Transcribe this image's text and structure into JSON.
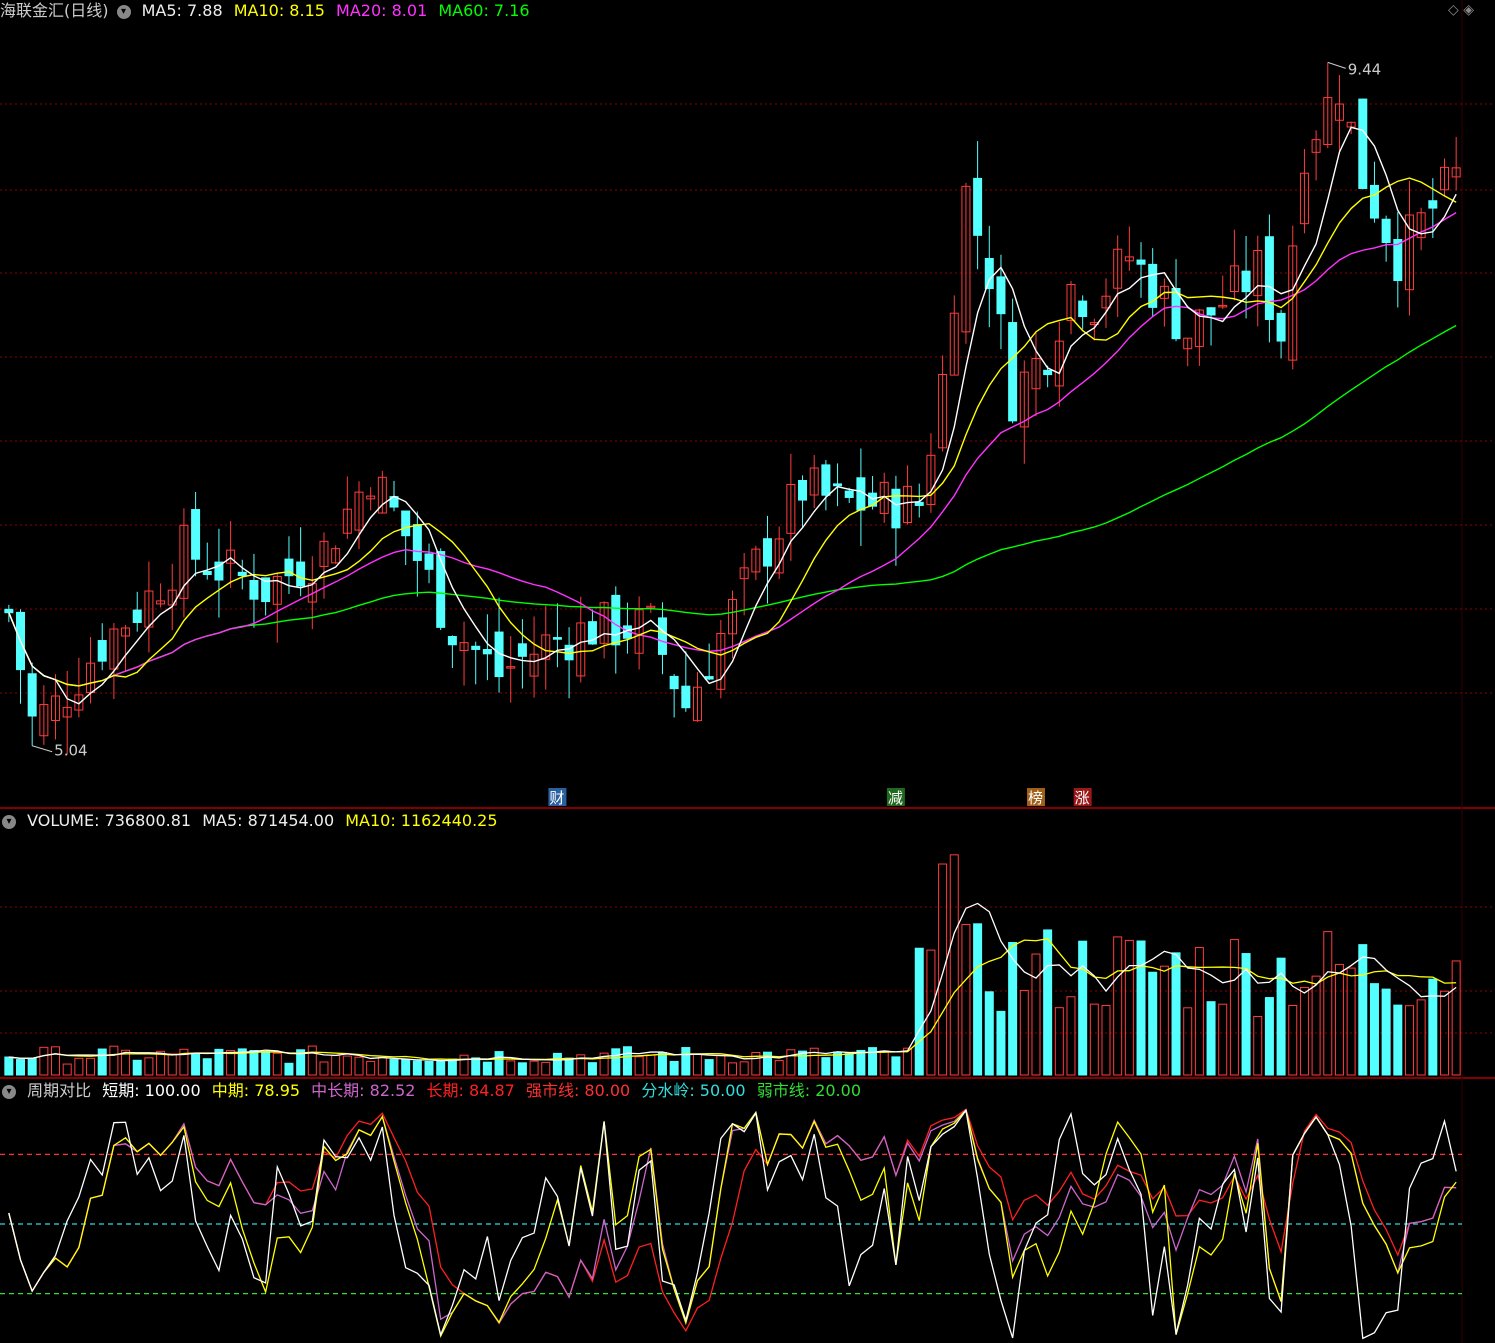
{
  "price_legend": {
    "title": "海联金汇(日线)",
    "ma5": "MA5: 7.88",
    "ma10": "MA10: 8.15",
    "ma20": "MA20: 8.01",
    "ma60": "MA60: 7.16"
  },
  "volume_legend": {
    "volume": "VOLUME: 736800.81",
    "ma5": "MA5: 871454.00",
    "ma10": "MA10: 1162440.25"
  },
  "osc_legend": {
    "title": "周期对比",
    "short": "短期: 100.00",
    "mid": "中期: 78.95",
    "midlong": "中长期: 82.52",
    "long": "长期: 84.87",
    "strong": "强市线: 80.00",
    "divide": "分水岭: 50.00",
    "weak": "弱市线: 20.00"
  },
  "annotations": {
    "high": "9.44",
    "low": "5.04"
  },
  "markers": [
    "财",
    "减",
    "榜",
    "涨"
  ],
  "colors": {
    "up": "#ff3c3c",
    "down": "#54ffff",
    "ma5": "#ffffff",
    "ma10": "#ffff00",
    "ma20": "#ff33ff",
    "ma60": "#00ff00",
    "grid": "#8a0000",
    "frame": "#b00000",
    "short": "#ffffff",
    "mid": "#ffff00",
    "midlong": "#cc66cc",
    "long": "#ff2020",
    "strong": "#ff3030",
    "divide": "#33dddd",
    "weak": "#33dd33"
  },
  "chart_data": [
    {
      "type": "candlestick",
      "title": "海联金汇(日线)",
      "ylim": [
        4.8,
        9.7
      ],
      "series_names": [
        "MA5",
        "MA10",
        "MA20",
        "MA60"
      ],
      "ohlc": []
    },
    {
      "type": "bar",
      "title": "VOLUME",
      "series_names": [
        "MA5",
        "MA10"
      ],
      "ylim": [
        0,
        3300000
      ],
      "values": []
    },
    {
      "type": "line",
      "title": "周期对比",
      "ylim": [
        0,
        100
      ],
      "reference_lines": [
        80,
        50,
        20
      ],
      "series_names": [
        "短期",
        "中期",
        "中长期",
        "长期"
      ]
    }
  ]
}
